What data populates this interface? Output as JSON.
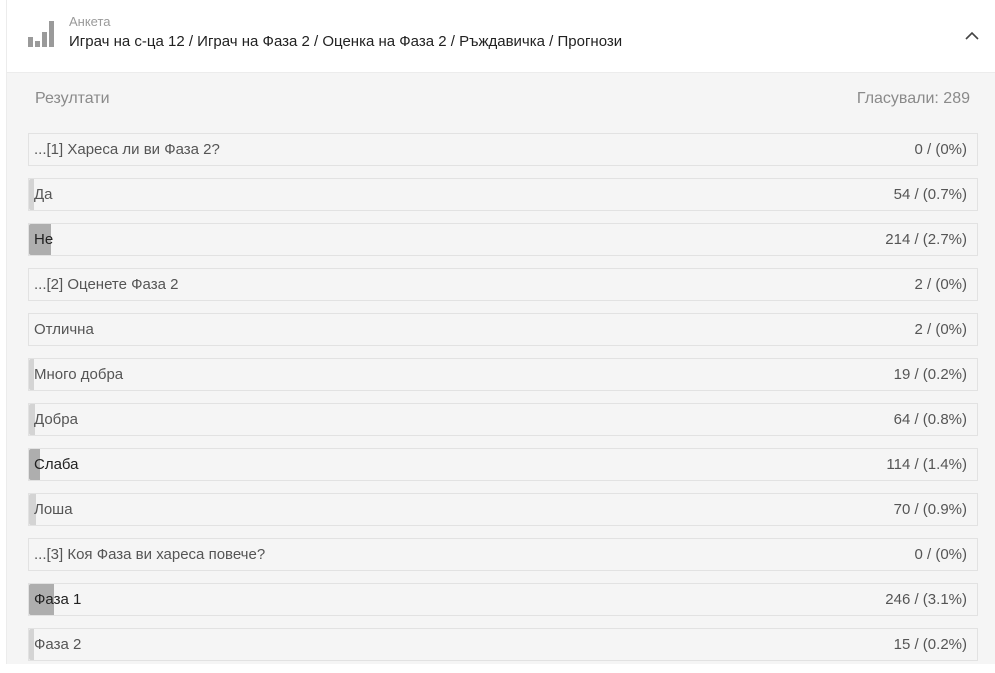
{
  "header": {
    "subtitle": "Анкета",
    "title": "Играч на с-ца 12 / Играч на Фаза 2 / Оценка на Фаза 2 / Ръждавичка / Прогнози",
    "icon": "bar-chart-icon",
    "collapse_icon": "chevron-up-icon"
  },
  "results": {
    "label": "Резултати",
    "votes_text": "Гласували: 289"
  },
  "rows": [
    {
      "label": "...[1] Хареса ли ви Фаза 2?",
      "count": "0 / (0%)",
      "fill": 0
    },
    {
      "label": "Да",
      "count": "54 / (0.7%)",
      "fill": 0.006
    },
    {
      "label": "Не",
      "count": "214 / (2.7%)",
      "fill": 0.027
    },
    {
      "label": "...[2] Оценете Фаза 2",
      "count": "2 / (0%)",
      "fill": 0
    },
    {
      "label": "Отлична",
      "count": "2 / (0%)",
      "fill": 0
    },
    {
      "label": "Много добра",
      "count": "19 / (0.2%)",
      "fill": 0.002
    },
    {
      "label": "Добра",
      "count": "64 / (0.8%)",
      "fill": 0.008
    },
    {
      "label": "Слаба",
      "count": "114 / (1.4%)",
      "fill": 0.014
    },
    {
      "label": "Лоша",
      "count": "70 / (0.9%)",
      "fill": 0.009
    },
    {
      "label": "...[3] Коя Фаза ви хареса повече?",
      "count": "0 / (0%)",
      "fill": 0
    },
    {
      "label": "Фаза 1",
      "count": "246 / (3.1%)",
      "fill": 0.031
    },
    {
      "label": "Фаза 2",
      "count": "15 / (0.2%)",
      "fill": 0.002
    }
  ]
}
